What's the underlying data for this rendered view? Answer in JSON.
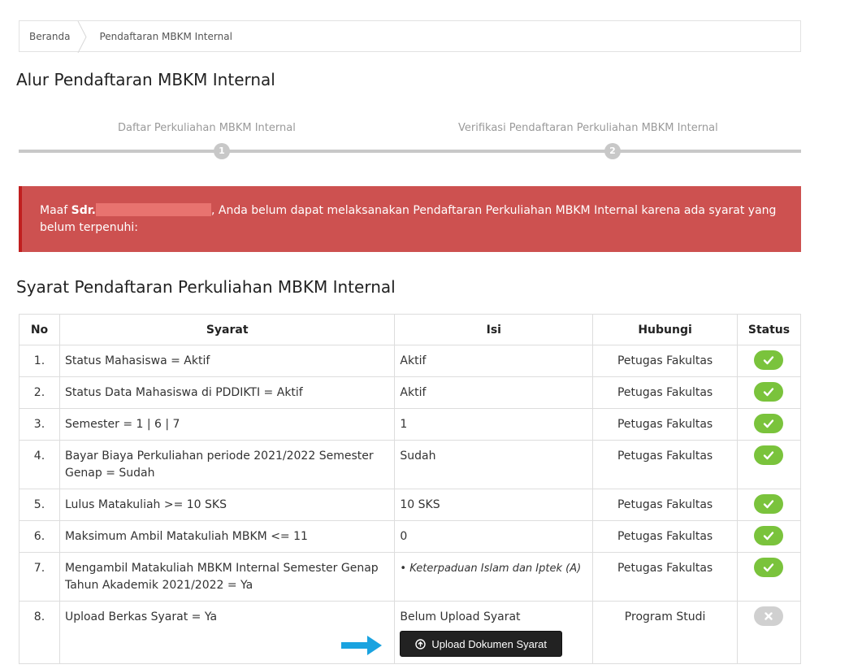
{
  "breadcrumb": {
    "home": "Beranda",
    "current": "Pendaftaran MBKM Internal"
  },
  "alur_title": "Alur Pendaftaran MBKM Internal",
  "steps": [
    {
      "label": "Daftar Perkuliahan MBKM Internal",
      "number": "1"
    },
    {
      "label": "Verifikasi Pendaftaran Perkuliahan MBKM Internal",
      "number": "2"
    }
  ],
  "alert": {
    "prefix": "Maaf ",
    "salutation": "Sdr.",
    "message": ", Anda belum dapat melaksanakan Pendaftaran Perkuliahan MBKM Internal karena ada syarat yang belum terpenuhi:"
  },
  "syarat_title": "Syarat Pendaftaran Perkuliahan MBKM Internal",
  "table": {
    "headers": {
      "no": "No",
      "syarat": "Syarat",
      "isi": "Isi",
      "hubungi": "Hubungi",
      "status": "Status"
    },
    "rows": [
      {
        "no": "1.",
        "syarat": "Status Mahasiswa = Aktif",
        "isi": "Aktif",
        "hubungi": "Petugas Fakultas",
        "status": "ok"
      },
      {
        "no": "2.",
        "syarat": "Status Data Mahasiswa di PDDIKTI = Aktif",
        "isi": "Aktif",
        "hubungi": "Petugas Fakultas",
        "status": "ok"
      },
      {
        "no": "3.",
        "syarat": "Semester = 1 | 6 | 7",
        "isi": "1",
        "hubungi": "Petugas Fakultas",
        "status": "ok"
      },
      {
        "no": "4.",
        "syarat": "Bayar Biaya Perkuliahan periode 2021/2022 Semester Genap = Sudah",
        "isi": "Sudah",
        "hubungi": "Petugas Fakultas",
        "status": "ok"
      },
      {
        "no": "5.",
        "syarat": "Lulus Matakuliah >= 10 SKS",
        "isi": "10 SKS",
        "hubungi": "Petugas Fakultas",
        "status": "ok"
      },
      {
        "no": "6.",
        "syarat": "Maksimum Ambil Matakuliah MBKM <= 11",
        "isi": "0",
        "hubungi": "Petugas Fakultas",
        "status": "ok"
      },
      {
        "no": "7.",
        "syarat": "Mengambil Matakuliah MBKM Internal Semester Genap Tahun Akademik 2021/2022 = Ya",
        "isi": "• Keterpaduan Islam dan Iptek (A)",
        "hubungi": "Petugas Fakultas",
        "status": "ok"
      },
      {
        "no": "8.",
        "syarat": "Upload Berkas Syarat = Ya",
        "isi": "Belum Upload Syarat",
        "hubungi": "Program Studi",
        "status": "fail"
      }
    ],
    "upload_button": "Upload Dokumen Syarat"
  },
  "colors": {
    "alert_bg": "#cd5150",
    "ok_badge": "#7ac33c",
    "fail_badge": "#d0d0d0",
    "arrow": "#1aa3e0"
  }
}
